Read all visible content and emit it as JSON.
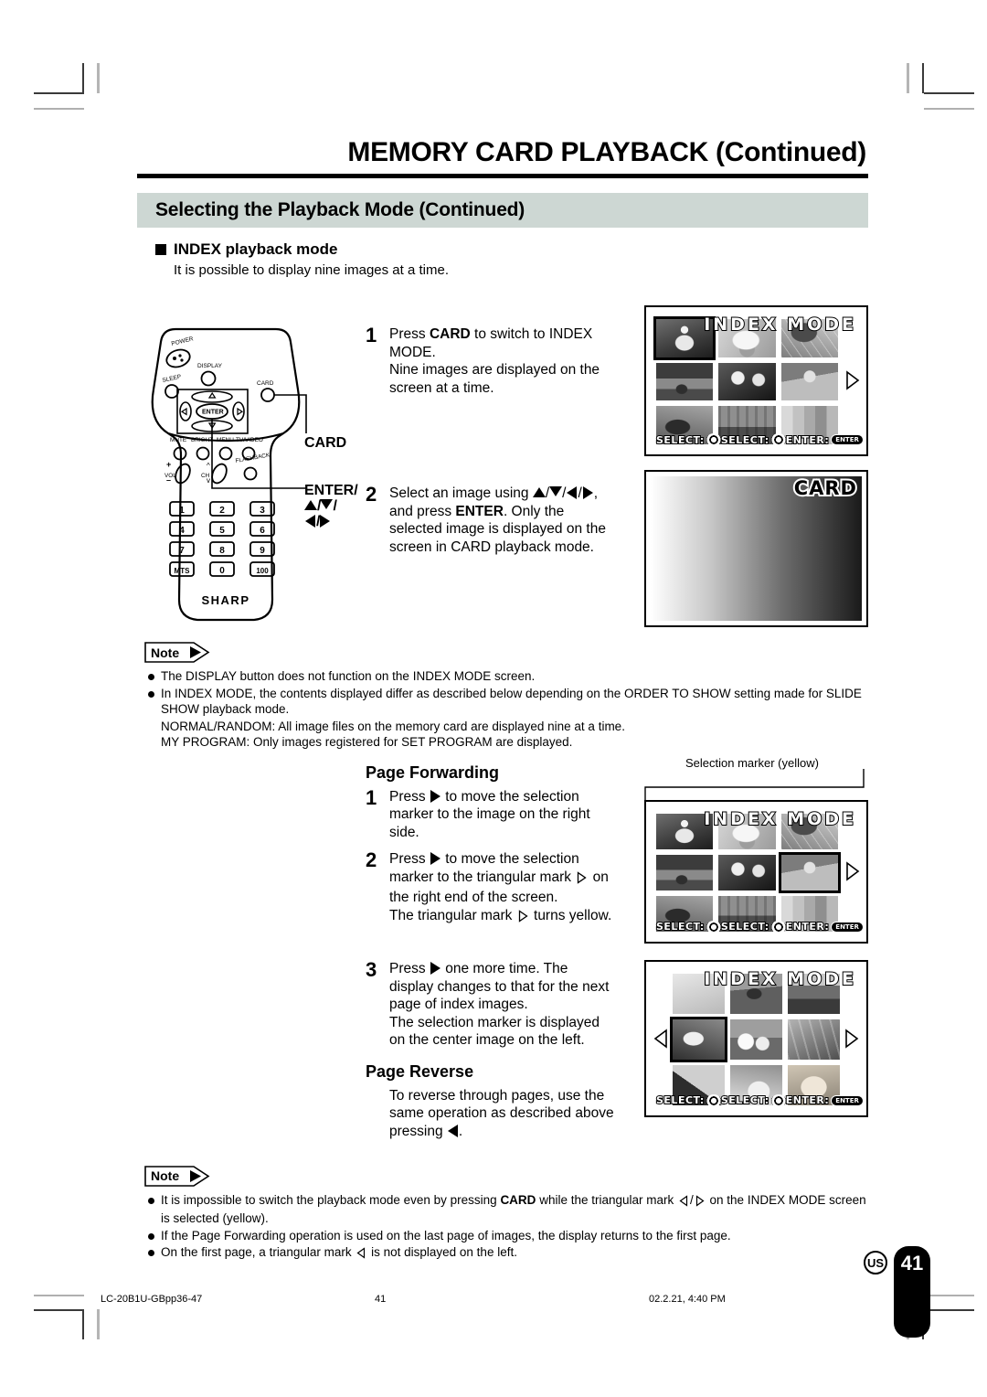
{
  "header": {
    "chapter_title": "MEMORY CARD PLAYBACK (Continued)",
    "section_title": "Selecting the Playback Mode (Continued)"
  },
  "subsection": {
    "title": "INDEX playback mode",
    "description": "It is possible to display nine images at a time."
  },
  "remote": {
    "brand": "SHARP",
    "buttons": {
      "power": "POWER",
      "sleep": "SLEEP",
      "display": "DISPLAY",
      "card": "CARD",
      "enter": "ENTER",
      "mute": "MUTE",
      "bright": "BRIGHT",
      "menu": "MENU",
      "tv_video": "TV/VIDEO",
      "flashback": "FLASHBACK",
      "vol": "VOL",
      "ch": "CH",
      "plus": "+",
      "minus": "–"
    },
    "keypad": [
      "1",
      "2",
      "3",
      "4",
      "5",
      "6",
      "7",
      "8",
      "9",
      "MTS",
      "0",
      "100"
    ],
    "callouts": {
      "card": "CARD",
      "enter": "ENTER/"
    }
  },
  "steps_top": [
    {
      "num": "1",
      "lines": [
        {
          "parts": [
            {
              "t": "Press ",
              "b": false
            },
            {
              "t": "CARD",
              "b": true
            },
            {
              "t": " to switch to INDEX",
              "b": false
            }
          ]
        },
        {
          "parts": [
            {
              "t": "MODE.",
              "b": false
            }
          ]
        },
        {
          "parts": [
            {
              "t": "Nine images are displayed on the",
              "b": false
            }
          ]
        },
        {
          "parts": [
            {
              "t": "screen at a time.",
              "b": false
            }
          ]
        }
      ]
    },
    {
      "num": "2",
      "lines": [
        {
          "parts": [
            {
              "t": "Select an image using ",
              "b": false
            },
            {
              "t": "▲/▼/◀/ ▶,",
              "b": false,
              "sym": true
            }
          ]
        },
        {
          "parts": [
            {
              "t": "and press ",
              "b": false
            },
            {
              "t": "ENTER",
              "b": true
            },
            {
              "t": ". Only the",
              "b": false
            }
          ]
        },
        {
          "parts": [
            {
              "t": "selected image is displayed on the",
              "b": false
            }
          ]
        },
        {
          "parts": [
            {
              "t": "screen in CARD playback mode.",
              "b": false
            }
          ]
        }
      ]
    }
  ],
  "screens": {
    "index_mode_label": "INDEX MODE",
    "card_label": "CARD",
    "select_label": "SELECT:",
    "enter_label": "ENTER:",
    "enter_icon_label": "ENTER",
    "selection_marker_callout": "Selection marker (yellow)"
  },
  "note_top": {
    "badge": "Note",
    "items": [
      {
        "parts": [
          {
            "t": "The DISPLAY button does not function on the INDEX MODE screen.",
            "b": false
          }
        ]
      },
      {
        "parts": [
          {
            "t": "In INDEX MODE, the contents displayed differ as described below depending on the ORDER TO SHOW setting made for SLIDE SHOW playback mode.",
            "b": false
          }
        ]
      }
    ],
    "extra_lines": [
      "NORMAL/RANDOM: All image files on the memory card are displayed nine at a time.",
      "MY PROGRAM: Only images registered for SET PROGRAM are displayed."
    ]
  },
  "page_forwarding": {
    "title": "Page Forwarding",
    "steps": [
      {
        "num": "1",
        "lines": [
          {
            "parts": [
              {
                "t": "Press ",
                "b": false
              },
              {
                "t": "▶",
                "sym": "tri-filled-right"
              },
              {
                "t": " to move the selection",
                "b": false
              }
            ]
          },
          {
            "parts": [
              {
                "t": "marker to the image on the right",
                "b": false
              }
            ]
          },
          {
            "parts": [
              {
                "t": "side.",
                "b": false
              }
            ]
          }
        ]
      },
      {
        "num": "2",
        "lines": [
          {
            "parts": [
              {
                "t": "Press ",
                "b": false
              },
              {
                "t": "▶",
                "sym": "tri-filled-right"
              },
              {
                "t": " to move the selection",
                "b": false
              }
            ]
          },
          {
            "parts": [
              {
                "t": "marker to the triangular mark ",
                "b": false
              },
              {
                "t": "▷",
                "sym": "tri-outline-right"
              },
              {
                "t": " on",
                "b": false
              }
            ]
          },
          {
            "parts": [
              {
                "t": "the right end of the screen.",
                "b": false
              }
            ]
          },
          {
            "parts": [
              {
                "t": "The triangular mark ",
                "b": false
              },
              {
                "t": "▷",
                "sym": "tri-outline-right"
              },
              {
                "t": " turns yellow.",
                "b": false
              }
            ]
          }
        ]
      },
      {
        "num": "3",
        "lines": [
          {
            "parts": [
              {
                "t": "Press ",
                "b": false
              },
              {
                "t": "▶",
                "sym": "tri-filled-right"
              },
              {
                "t": " one more time. The",
                "b": false
              }
            ]
          },
          {
            "parts": [
              {
                "t": "display changes to that for the next",
                "b": false
              }
            ]
          },
          {
            "parts": [
              {
                "t": "page of index images.",
                "b": false
              }
            ]
          },
          {
            "parts": [
              {
                "t": "The selection marker is displayed",
                "b": false
              }
            ]
          },
          {
            "parts": [
              {
                "t": "on the center image on the left.",
                "b": false
              }
            ]
          }
        ]
      }
    ]
  },
  "page_reverse": {
    "title": "Page Reverse",
    "lines": [
      {
        "parts": [
          {
            "t": "To reverse through pages, use the",
            "b": false
          }
        ]
      },
      {
        "parts": [
          {
            "t": "same operation as described above",
            "b": false
          }
        ]
      },
      {
        "parts": [
          {
            "t": "pressing ",
            "b": false
          },
          {
            "t": "◀",
            "sym": "tri-filled-left"
          },
          {
            "t": ".",
            "b": false
          }
        ]
      }
    ]
  },
  "note_bottom": {
    "badge": "Note",
    "items": [
      {
        "pre": "It is impossible to switch the playback mode even by pressing ",
        "bold": "CARD",
        "mid": " while the triangular mark ",
        "sym": "◁/▷",
        "post": " on the INDEX MODE screen is selected (yellow)."
      },
      {
        "pre": "If the Page Forwarding operation is used on the last page of images, the display returns to the first page."
      },
      {
        "pre": "On the first page, a triangular mark ",
        "sym": "◁",
        "post": " is not displayed on the left."
      }
    ]
  },
  "footer": {
    "doc_id": "LC-20B1U-GBpp36-47",
    "page_center": "41",
    "timestamp": "02.2.21, 4:40 PM",
    "region_mark": "US",
    "page_tab": "41"
  },
  "colors": {
    "section_bar": "#cdd7d3",
    "ink": "#000000",
    "rule": "#000000"
  }
}
